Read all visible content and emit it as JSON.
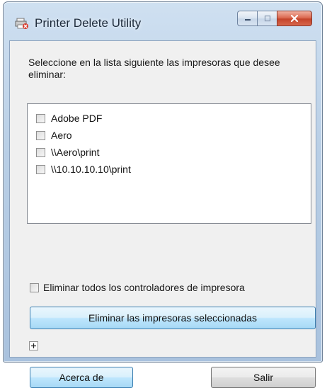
{
  "window": {
    "title": "Printer Delete Utility",
    "icon": "printer-delete-icon"
  },
  "dialog": {
    "instruction": "Seleccione en la lista siguiente las impresoras que desee eliminar:",
    "printers": [
      {
        "label": "Adobe PDF",
        "checked": false
      },
      {
        "label": "Aero",
        "checked": false
      },
      {
        "label": "\\\\Aero\\print",
        "checked": false
      },
      {
        "label": "\\\\10.10.10.10\\print",
        "checked": false
      }
    ],
    "remove_all_drivers": {
      "label": "Eliminar todos los controladores de impresora",
      "checked": false
    },
    "delete_button": "Eliminar las impresoras seleccionadas",
    "expand_icon": "plus-icon",
    "about_button": "Acerca de",
    "exit_button": "Salir"
  },
  "colors": {
    "accent_button": "#bee6fd",
    "close_button": "#c4442a",
    "titlebar": "#b9cfe6"
  }
}
